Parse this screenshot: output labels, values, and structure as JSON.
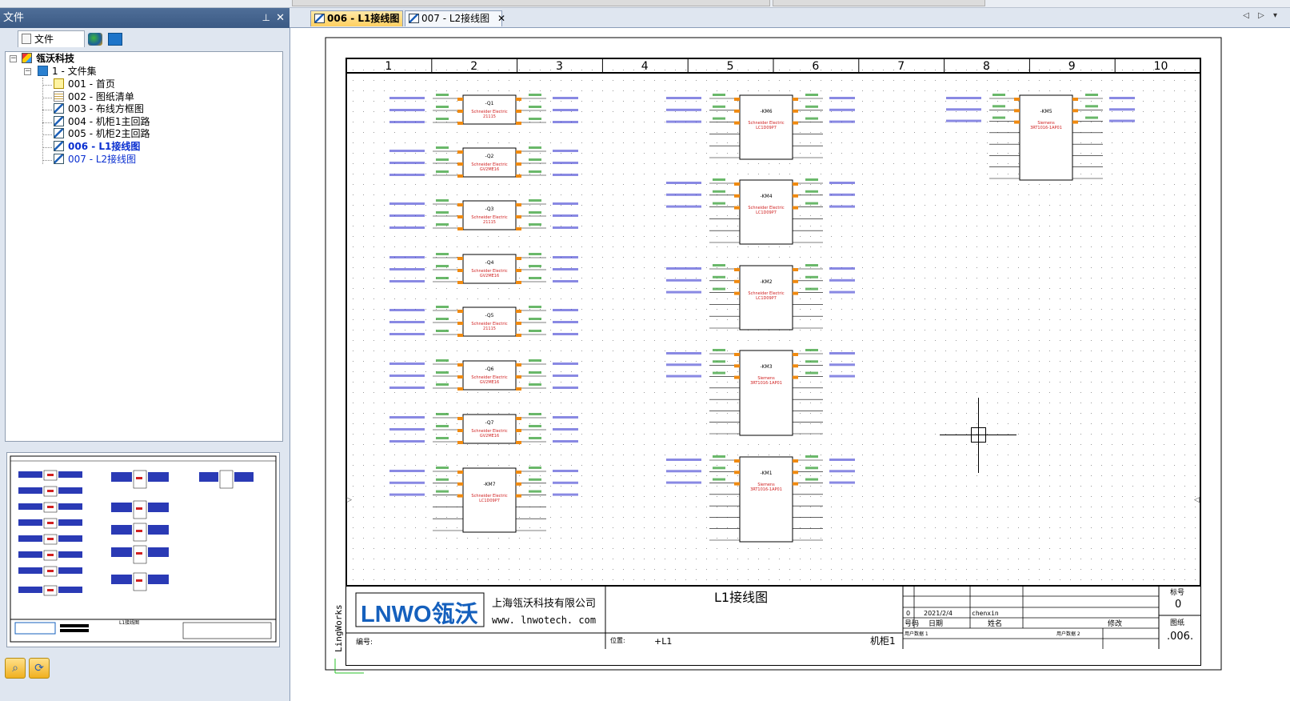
{
  "panel": {
    "title": "文件",
    "pin_glyph": "📌",
    "close_glyph": "✕",
    "tab_label": "文件"
  },
  "tree": {
    "root": "瓴沃科技",
    "collection": "1 - 文件集",
    "items": [
      {
        "label": "001 - 首页",
        "icon": "home-page-icon",
        "state": "normal"
      },
      {
        "label": "002 - 图纸清单",
        "icon": "list-sheet-icon",
        "state": "normal"
      },
      {
        "label": "003 - 布线方框图",
        "icon": "schematic-sheet-icon",
        "state": "normal"
      },
      {
        "label": "004 - 机柜1主回路",
        "icon": "schematic-sheet-icon",
        "state": "normal"
      },
      {
        "label": "005 - 机柜2主回路",
        "icon": "schematic-sheet-icon",
        "state": "normal"
      },
      {
        "label": "006 - L1接线图",
        "icon": "schematic-sheet-icon",
        "state": "active"
      },
      {
        "label": "007 - L2接线图",
        "icon": "schematic-sheet-icon",
        "state": "open"
      }
    ]
  },
  "doc_tabs": [
    {
      "label": "006 - L1接线图",
      "active": true
    },
    {
      "label": "007 - L2接线图",
      "active": false
    }
  ],
  "drawing": {
    "columns": [
      "1",
      "2",
      "3",
      "4",
      "5",
      "6",
      "7",
      "8",
      "9",
      "10"
    ],
    "company_logo_text": "LNWO瓴沃",
    "company_name": "上海瓴沃科技有限公司",
    "company_url": "www. lnwotech. com",
    "sheet_title": "L1接线图",
    "side_text": "LingWorks",
    "number_label": "编号:",
    "location_label": "位置:",
    "location_value": "+L1",
    "cabinet": "机柜1",
    "revision": {
      "no": "0",
      "date": "2021/2/4",
      "name": "chenxin"
    },
    "rev_headers": [
      "号码",
      "日期",
      "姓名",
      "修改"
    ],
    "user_data_1": "用户数据 1",
    "user_data_2": "用户数据 2",
    "mark_label": "标号",
    "mark_value": "0",
    "sheet_label": "图纸",
    "sheet_value": ".006.",
    "preview_title": "L1接线图",
    "components": [
      {
        "tag": "-Q1",
        "maker": "Schneider Electric",
        "model": "21115",
        "col": 0,
        "row": 0
      },
      {
        "tag": "-Q2",
        "maker": "Schneider Electric",
        "model": "GV2ME16",
        "col": 0,
        "row": 1
      },
      {
        "tag": "-Q3",
        "maker": "Schneider Electric",
        "model": "21115",
        "col": 0,
        "row": 2
      },
      {
        "tag": "-Q4",
        "maker": "Schneider Electric",
        "model": "GV2ME16",
        "col": 0,
        "row": 3
      },
      {
        "tag": "-Q5",
        "maker": "Schneider Electric",
        "model": "21115",
        "col": 0,
        "row": 4
      },
      {
        "tag": "-Q6",
        "maker": "Schneider Electric",
        "model": "GV2ME16",
        "col": 0,
        "row": 5
      },
      {
        "tag": "-Q7",
        "maker": "Schneider Electric",
        "model": "GV2ME16",
        "col": 0,
        "row": 6
      },
      {
        "tag": "-KM7",
        "maker": "Schneider Electric",
        "model": "LC1D09P7",
        "col": 0,
        "row": 7
      },
      {
        "tag": "-KM6",
        "maker": "Schneider Electric",
        "model": "LC1D09P7",
        "col": 1,
        "row": 0
      },
      {
        "tag": "-KM4",
        "maker": "Schneider Electric",
        "model": "LC1D09P7",
        "col": 1,
        "row": 1
      },
      {
        "tag": "-KM2",
        "maker": "Schneider Electric",
        "model": "LC1D09P7",
        "col": 1,
        "row": 2
      },
      {
        "tag": "-KM3",
        "maker": "Siemens",
        "model": "3RT1016-1AP01",
        "col": 1,
        "row": 3
      },
      {
        "tag": "-KM1",
        "maker": "Siemens",
        "model": "3RT1016-1AP01",
        "col": 1,
        "row": 4
      },
      {
        "tag": "-KM5",
        "maker": "Siemens",
        "model": "3RT1016-1AP01",
        "col": 2,
        "row": 0
      }
    ]
  },
  "colors": {
    "wire_label": "#2b9a2b",
    "terminal": "#f08a10",
    "component_text": "#d02020",
    "net_label": "#3a3ad0"
  }
}
